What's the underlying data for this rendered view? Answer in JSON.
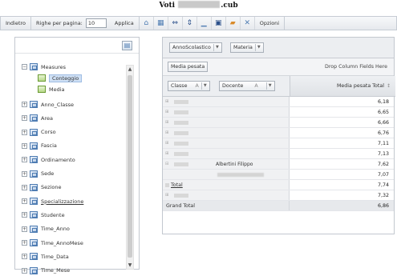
{
  "window": {
    "title_left": "Voti",
    "title_right": ".cub"
  },
  "toolbar": {
    "indietro": "Indietro",
    "righe_label": "Righe per pagina:",
    "righe_value": "10",
    "applica": "Applica",
    "opzioni": "Opzioni"
  },
  "tree": {
    "root": "Measures",
    "measures": [
      "Conteggio",
      "Media"
    ],
    "dimensions": [
      "Anno_Classe",
      "Area",
      "Corso",
      "Fascia",
      "Ordinamento",
      "Sede",
      "Sezione",
      "Specializzazione",
      "Studente",
      "Time_Anno",
      "Time_AnnoMese",
      "Time_Data",
      "Time_Mese"
    ]
  },
  "pivot": {
    "filters": [
      "AnnoScolastico",
      "Materia"
    ],
    "data_field": "Media pesata",
    "drop_hint": "Drop Column Fields Here",
    "row_fields": [
      "Classe",
      "Docente"
    ],
    "value_header": "Media pesata Total",
    "teacher": "Albertini Filippo",
    "total_label": "Total",
    "grand_total_label": "Grand Total",
    "values": [
      "6,18",
      "6,65",
      "6,66",
      "6,76",
      "7,11",
      "7,13",
      "7,62",
      "7,07",
      "7,74",
      "7,32",
      "6,86"
    ]
  }
}
